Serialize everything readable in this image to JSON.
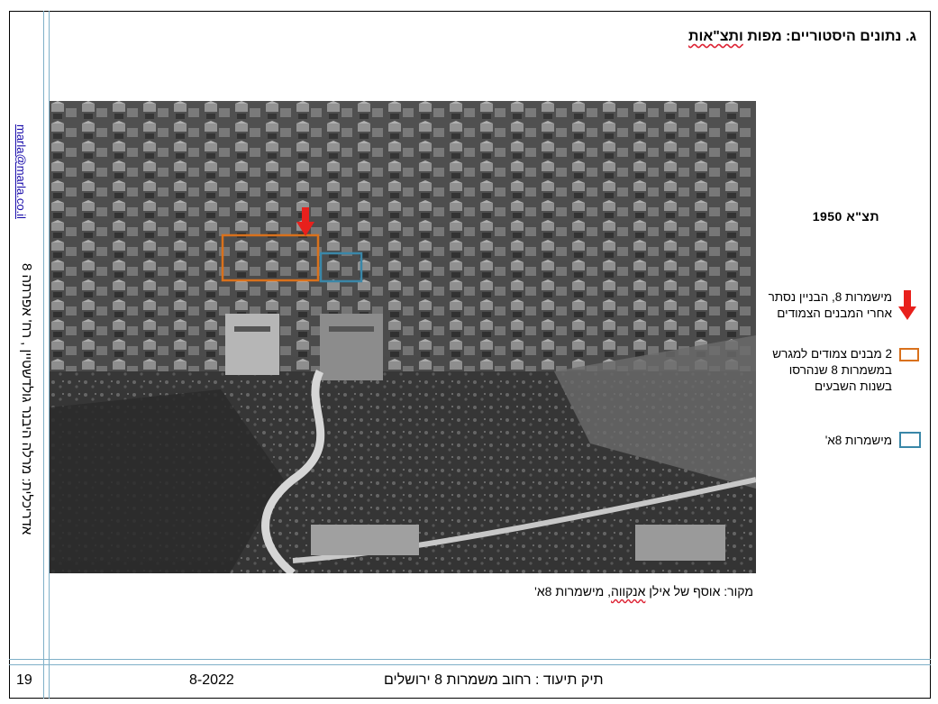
{
  "header": {
    "title_part1": "ג. נתונים היסטוריים: מפות ",
    "title_part2": "ותצ\"אות"
  },
  "sidebar": {
    "email": "marla@marla.co.il",
    "author_line": "אדריכלית: מרלה היבנר גולדשטיין , רח' אפרתה 8"
  },
  "photo": {
    "title": "תצ\"א 1950",
    "caption_prefix": "מקור: אוסף של אילן ",
    "caption_wavy": "אנקווה",
    "caption_suffix": ", מישמרות 8א'"
  },
  "legend": {
    "items": [
      {
        "text": "מישמרות 8, הבניין נסתר אחרי המבנים הצמודים",
        "marker": "red-arrow",
        "color": "#e8201c"
      },
      {
        "text": "2 מבנים צמודים למגרש במשמרות 8 שנהרסו בשנות השבעים",
        "marker": "orange-box",
        "color": "#d9711c"
      },
      {
        "text": "מישמרות 8א'",
        "marker": "blue-box",
        "color": "#3a87a8"
      }
    ]
  },
  "footer": {
    "page_number": "19",
    "date": "8-2022",
    "file_title": "תיק תיעוד : רחוב משמרות 8   ירושלים"
  }
}
